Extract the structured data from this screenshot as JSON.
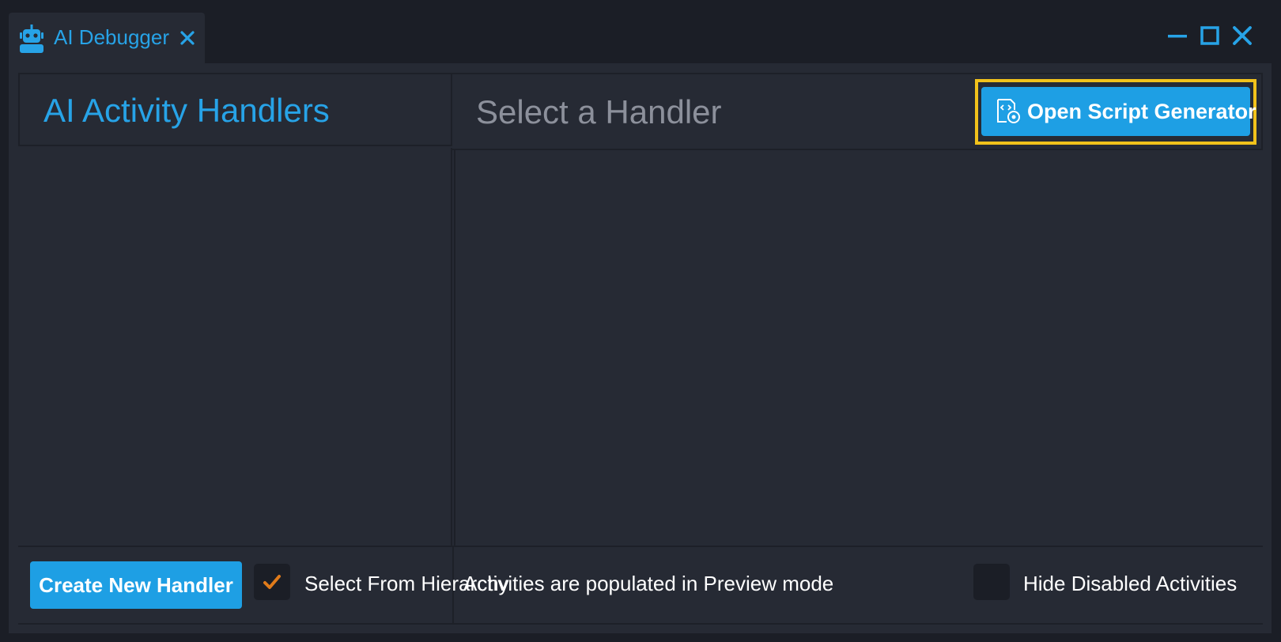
{
  "tab": {
    "title": "AI Debugger",
    "icon": "robot-icon"
  },
  "window_controls": {
    "minimize_icon": "minimize-icon",
    "maximize_icon": "maximize-icon",
    "close_icon": "close-icon"
  },
  "left_panel": {
    "title": "AI Activity Handlers",
    "items": []
  },
  "right_panel": {
    "title": "Select a Handler",
    "generator_button_label": "Open Script Generator",
    "generator_button_icon": "script-generator-icon"
  },
  "footer": {
    "create_button_label": "Create New Handler",
    "select_from_hierarchy": {
      "label": "Select From Hierarchy",
      "checked": true
    },
    "status_text": "Activities are populated in Preview mode",
    "hide_disabled": {
      "label": "Hide Disabled Activities",
      "checked": false
    }
  },
  "colors": {
    "accent": "#1e9fe4",
    "title_blue": "#27a3e7",
    "highlight": "#f2c21b",
    "checkmark": "#e07b1a",
    "background": "#1b1e26",
    "panel": "#262a34"
  }
}
